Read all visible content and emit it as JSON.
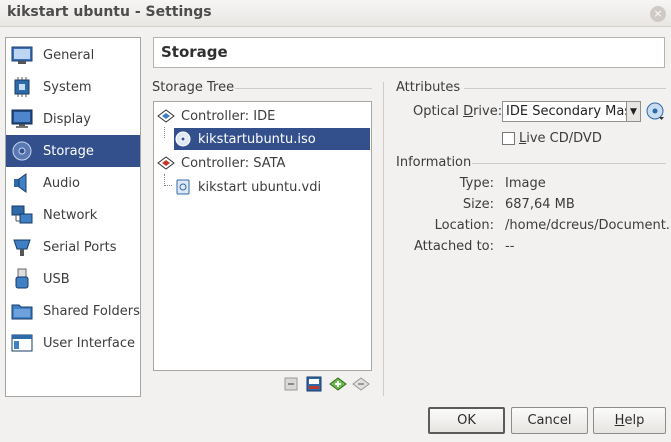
{
  "window": {
    "title": "kikstart ubuntu - Settings",
    "close_glyph": "×"
  },
  "sidebar": {
    "items": [
      {
        "label": "General",
        "icon": "general-icon"
      },
      {
        "label": "System",
        "icon": "system-chip-icon"
      },
      {
        "label": "Display",
        "icon": "display-monitor-icon"
      },
      {
        "label": "Storage",
        "icon": "storage-disk-icon",
        "selected": true
      },
      {
        "label": "Audio",
        "icon": "audio-speaker-icon"
      },
      {
        "label": "Network",
        "icon": "network-icon"
      },
      {
        "label": "Serial Ports",
        "icon": "serial-port-icon"
      },
      {
        "label": "USB",
        "icon": "usb-icon"
      },
      {
        "label": "Shared Folders",
        "icon": "shared-folder-icon"
      },
      {
        "label": "User Interface",
        "icon": "user-interface-icon"
      }
    ]
  },
  "page": {
    "title": "Storage"
  },
  "tree": {
    "header": "Storage Tree",
    "rows": [
      {
        "label": "Controller: IDE",
        "kind": "controller"
      },
      {
        "label": "kikstartubuntu.iso",
        "kind": "optical",
        "selected": true
      },
      {
        "label": "Controller: SATA",
        "kind": "controller"
      },
      {
        "label": "kikstart ubuntu.vdi",
        "kind": "harddisk"
      }
    ]
  },
  "attributes": {
    "header": "Attributes",
    "optical_drive_label_pre": "Optical ",
    "optical_drive_label_ul": "D",
    "optical_drive_label_post": "rive:",
    "optical_drive_value": "IDE Secondary Master",
    "live_cd_label_pre": "",
    "live_cd_label_ul": "L",
    "live_cd_label_post": "ive CD/DVD",
    "live_cd_checked": false
  },
  "information": {
    "header": "Information",
    "rows": [
      {
        "key": "Type:",
        "value": "Image"
      },
      {
        "key": "Size:",
        "value": "687,64 MB"
      },
      {
        "key": "Location:",
        "value": "/home/dcreus/Document..."
      },
      {
        "key": "Attached to:",
        "value": "--"
      }
    ]
  },
  "buttons": {
    "ok": "OK",
    "cancel": "Cancel",
    "help_ul": "H",
    "help_rest": "elp"
  },
  "colors": {
    "selection": "#33508d",
    "window_bg": "#f2f1f0"
  }
}
